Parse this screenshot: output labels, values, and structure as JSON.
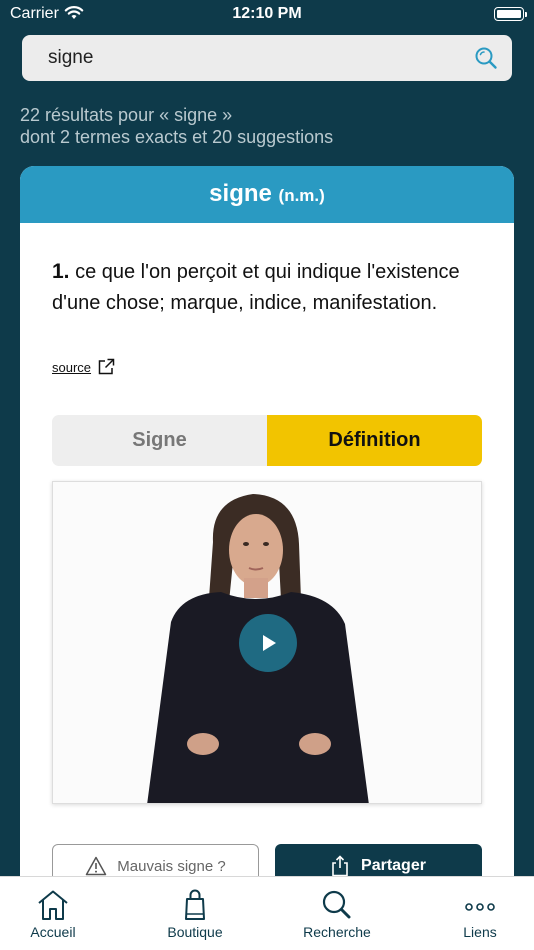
{
  "status_bar": {
    "carrier": "Carrier",
    "time": "12:10 PM"
  },
  "search": {
    "value": "signe"
  },
  "results": {
    "line1": "22 résultats pour « signe »",
    "line2": "dont 2 termes exacts et 20 suggestions"
  },
  "entry": {
    "word": "signe",
    "pos": "(n.m.)",
    "number": "1.",
    "definition": "ce que l'on perçoit et qui indique l'existence d'une chose; marque, indice, manifestation.",
    "source_label": "source"
  },
  "toggle": {
    "option1": "Signe",
    "option2": "Définition",
    "selected": "Définition"
  },
  "actions": {
    "report": "Mauvais signe ?",
    "share": "Partager"
  },
  "tabs": [
    {
      "label": "Accueil",
      "icon": "home-icon"
    },
    {
      "label": "Boutique",
      "icon": "shopping-bag-icon"
    },
    {
      "label": "Recherche",
      "icon": "search-icon"
    },
    {
      "label": "Liens",
      "icon": "more-dots-icon"
    }
  ],
  "colors": {
    "background": "#0e3a4a",
    "header": "#2a9ac2",
    "accent": "#f2c400"
  }
}
